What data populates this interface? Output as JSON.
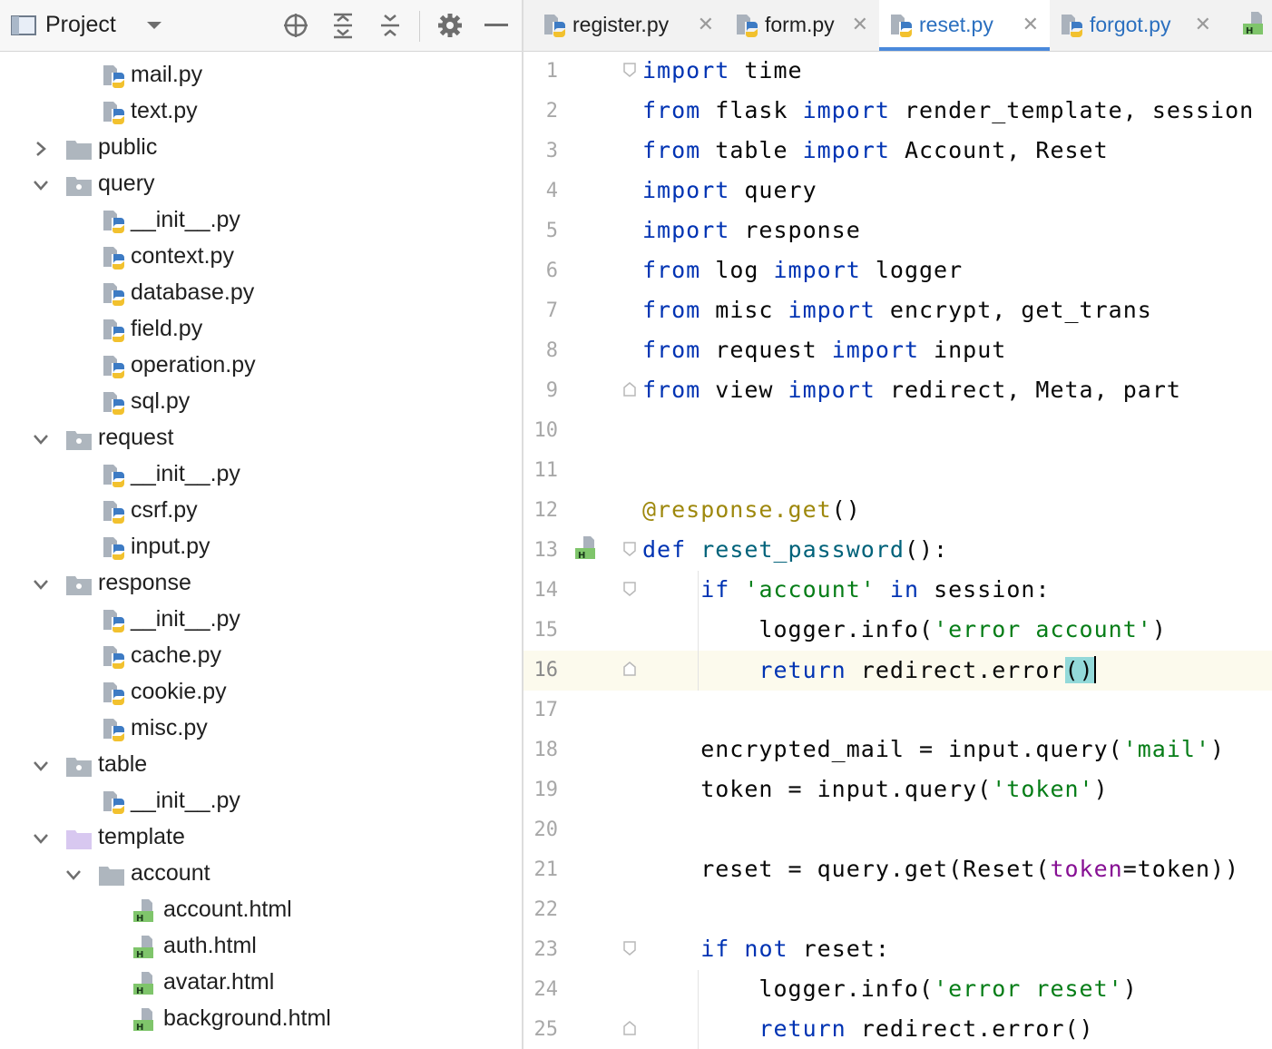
{
  "project_panel": {
    "title": "Project",
    "header_icons": [
      "project-view-icon",
      "dropdown-chevron-icon",
      "locate-icon",
      "expand-all-icon",
      "collapse-all-icon",
      "gear-icon",
      "minimize-icon"
    ],
    "tree": [
      {
        "label": "mail.py",
        "type": "py-file",
        "depth": 2
      },
      {
        "label": "text.py",
        "type": "py-file",
        "depth": 2
      },
      {
        "label": "public",
        "type": "folder",
        "depth": 1,
        "expanded": false
      },
      {
        "label": "query",
        "type": "package",
        "depth": 1,
        "expanded": true
      },
      {
        "label": "__init__.py",
        "type": "py-file",
        "depth": 2
      },
      {
        "label": "context.py",
        "type": "py-file",
        "depth": 2
      },
      {
        "label": "database.py",
        "type": "py-file",
        "depth": 2
      },
      {
        "label": "field.py",
        "type": "py-file",
        "depth": 2
      },
      {
        "label": "operation.py",
        "type": "py-file",
        "depth": 2
      },
      {
        "label": "sql.py",
        "type": "py-file",
        "depth": 2
      },
      {
        "label": "request",
        "type": "package",
        "depth": 1,
        "expanded": true
      },
      {
        "label": "__init__.py",
        "type": "py-file",
        "depth": 2
      },
      {
        "label": "csrf.py",
        "type": "py-file",
        "depth": 2
      },
      {
        "label": "input.py",
        "type": "py-file",
        "depth": 2
      },
      {
        "label": "response",
        "type": "package",
        "depth": 1,
        "expanded": true
      },
      {
        "label": "__init__.py",
        "type": "py-file",
        "depth": 2
      },
      {
        "label": "cache.py",
        "type": "py-file",
        "depth": 2
      },
      {
        "label": "cookie.py",
        "type": "py-file",
        "depth": 2
      },
      {
        "label": "misc.py",
        "type": "py-file",
        "depth": 2
      },
      {
        "label": "table",
        "type": "package",
        "depth": 1,
        "expanded": true
      },
      {
        "label": "__init__.py",
        "type": "py-file",
        "depth": 2
      },
      {
        "label": "template",
        "type": "template-folder",
        "depth": 1,
        "expanded": true
      },
      {
        "label": "account",
        "type": "folder",
        "depth": 2,
        "expanded": true
      },
      {
        "label": "account.html",
        "type": "html-file",
        "depth": 3
      },
      {
        "label": "auth.html",
        "type": "html-file",
        "depth": 3
      },
      {
        "label": "avatar.html",
        "type": "html-file",
        "depth": 3
      },
      {
        "label": "background.html",
        "type": "html-file",
        "depth": 3
      }
    ]
  },
  "editor": {
    "tabs": [
      {
        "label": "register.py",
        "icon": "python-file-icon",
        "active": false
      },
      {
        "label": "form.py",
        "icon": "python-file-icon",
        "active": false
      },
      {
        "label": "reset.py",
        "icon": "python-file-icon",
        "active": true
      },
      {
        "label": "forgot.py",
        "icon": "python-file-icon",
        "active": false
      }
    ],
    "overflow_tab_icon": "html-file-icon",
    "current_line": 16,
    "lines": [
      {
        "n": "1",
        "tokens": [
          [
            "kw",
            "import"
          ],
          [
            "t",
            " time"
          ]
        ]
      },
      {
        "n": "2",
        "tokens": [
          [
            "kw",
            "from"
          ],
          [
            "t",
            " flask "
          ],
          [
            "kw",
            "import"
          ],
          [
            "t",
            " render_template, session"
          ]
        ]
      },
      {
        "n": "3",
        "tokens": [
          [
            "kw",
            "from"
          ],
          [
            "t",
            " table "
          ],
          [
            "kw",
            "import"
          ],
          [
            "t",
            " Account, Reset"
          ]
        ]
      },
      {
        "n": "4",
        "tokens": [
          [
            "kw",
            "import"
          ],
          [
            "t",
            " query"
          ]
        ]
      },
      {
        "n": "5",
        "tokens": [
          [
            "kw",
            "import"
          ],
          [
            "t",
            " response"
          ]
        ]
      },
      {
        "n": "6",
        "tokens": [
          [
            "kw",
            "from"
          ],
          [
            "t",
            " log "
          ],
          [
            "kw",
            "import"
          ],
          [
            "t",
            " logger"
          ]
        ]
      },
      {
        "n": "7",
        "tokens": [
          [
            "kw",
            "from"
          ],
          [
            "t",
            " misc "
          ],
          [
            "kw",
            "import"
          ],
          [
            "t",
            " encrypt, get_trans"
          ]
        ]
      },
      {
        "n": "8",
        "tokens": [
          [
            "kw",
            "from"
          ],
          [
            "t",
            " request "
          ],
          [
            "kw",
            "import"
          ],
          [
            "t",
            " input"
          ]
        ]
      },
      {
        "n": "9",
        "tokens": [
          [
            "kw",
            "from"
          ],
          [
            "t",
            " view "
          ],
          [
            "kw",
            "import"
          ],
          [
            "t",
            " redirect, Meta, part"
          ]
        ]
      },
      {
        "n": "10",
        "tokens": []
      },
      {
        "n": "11",
        "tokens": []
      },
      {
        "n": "12",
        "tokens": [
          [
            "deco",
            "@response.get"
          ],
          [
            "t",
            "()"
          ]
        ]
      },
      {
        "n": "13",
        "tokens": [
          [
            "kw",
            "def"
          ],
          [
            "t",
            " "
          ],
          [
            "fn",
            "reset_password"
          ],
          [
            "t",
            "():"
          ]
        ]
      },
      {
        "n": "14",
        "tokens": [
          [
            "t",
            "    "
          ],
          [
            "kw",
            "if"
          ],
          [
            "t",
            " "
          ],
          [
            "str",
            "'account'"
          ],
          [
            "t",
            " "
          ],
          [
            "kw",
            "in"
          ],
          [
            "t",
            " session:"
          ]
        ]
      },
      {
        "n": "15",
        "tokens": [
          [
            "t",
            "        logger.info("
          ],
          [
            "str",
            "'error account'"
          ],
          [
            "t",
            ")"
          ]
        ]
      },
      {
        "n": "16",
        "tokens": [
          [
            "t",
            "        "
          ],
          [
            "kw",
            "return"
          ],
          [
            "t",
            " redirect.error"
          ],
          [
            "hl",
            "()"
          ],
          [
            "caret",
            ""
          ]
        ]
      },
      {
        "n": "17",
        "tokens": []
      },
      {
        "n": "18",
        "tokens": [
          [
            "t",
            "    encrypted_mail = input.query("
          ],
          [
            "str",
            "'mail'"
          ],
          [
            "t",
            ")"
          ]
        ]
      },
      {
        "n": "19",
        "tokens": [
          [
            "t",
            "    token = input.query("
          ],
          [
            "str",
            "'token'"
          ],
          [
            "t",
            ")"
          ]
        ]
      },
      {
        "n": "20",
        "tokens": []
      },
      {
        "n": "21",
        "tokens": [
          [
            "t",
            "    reset = query.get(Reset("
          ],
          [
            "param",
            "token"
          ],
          [
            "t",
            "=token))"
          ]
        ]
      },
      {
        "n": "22",
        "tokens": []
      },
      {
        "n": "23",
        "tokens": [
          [
            "t",
            "    "
          ],
          [
            "kw",
            "if"
          ],
          [
            "t",
            " "
          ],
          [
            "kw",
            "not"
          ],
          [
            "t",
            " reset:"
          ]
        ]
      },
      {
        "n": "24",
        "tokens": [
          [
            "t",
            "        logger.info("
          ],
          [
            "str",
            "'error reset'"
          ],
          [
            "t",
            ")"
          ]
        ]
      },
      {
        "n": "25",
        "tokens": [
          [
            "t",
            "        "
          ],
          [
            "kw",
            "return"
          ],
          [
            "t",
            " redirect.error()"
          ]
        ]
      }
    ],
    "gutter_marker_line": 13,
    "gutter_marker_icon": "html-template-gutter-icon"
  }
}
